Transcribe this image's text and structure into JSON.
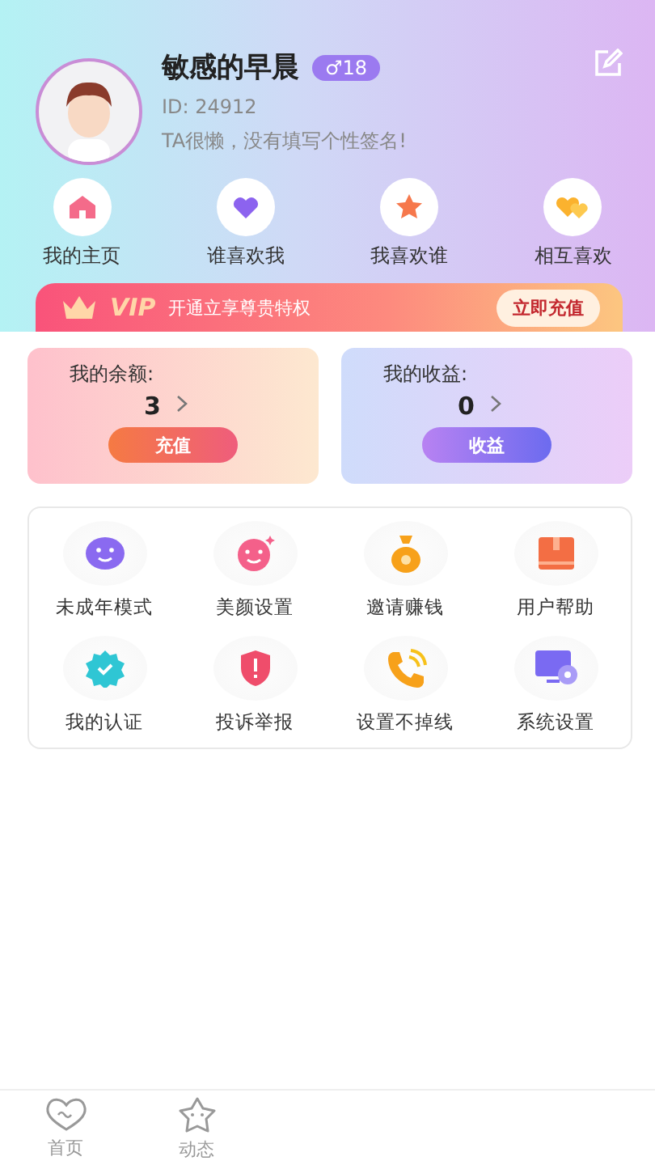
{
  "profile": {
    "name": "敏感的早晨",
    "badge": "♂18",
    "id": "ID: 24912",
    "signature": "TA很懒，没有填写个性签名!"
  },
  "quick_links": [
    {
      "label": "我的主页",
      "kind": "home"
    },
    {
      "label": "谁喜欢我",
      "kind": "heart"
    },
    {
      "label": "我喜欢谁",
      "kind": "star"
    },
    {
      "label": "相互喜欢",
      "kind": "hearts"
    }
  ],
  "vip": {
    "tag": "VIP",
    "text": "开通立享尊贵特权",
    "button": "立即充值"
  },
  "wallet": [
    {
      "kind": "balance",
      "label": "我的余额:",
      "value": "3",
      "button": "充值"
    },
    {
      "kind": "income",
      "label": "我的收益:",
      "value": "0",
      "button": "收益"
    }
  ],
  "menu": [
    {
      "label": "未成年模式",
      "kind": "baby"
    },
    {
      "label": "美颜设置",
      "kind": "beauty"
    },
    {
      "label": "邀请赚钱",
      "kind": "money"
    },
    {
      "label": "用户帮助",
      "kind": "book"
    },
    {
      "label": "我的认证",
      "kind": "verify"
    },
    {
      "label": "投诉举报",
      "kind": "report"
    },
    {
      "label": "设置不掉线",
      "kind": "phone"
    },
    {
      "label": "系统设置",
      "kind": "system"
    }
  ],
  "tab_bar": [
    {
      "label": "首页",
      "kind": "home",
      "selected": false
    },
    {
      "label": "动态",
      "kind": "moments",
      "selected": false
    }
  ]
}
